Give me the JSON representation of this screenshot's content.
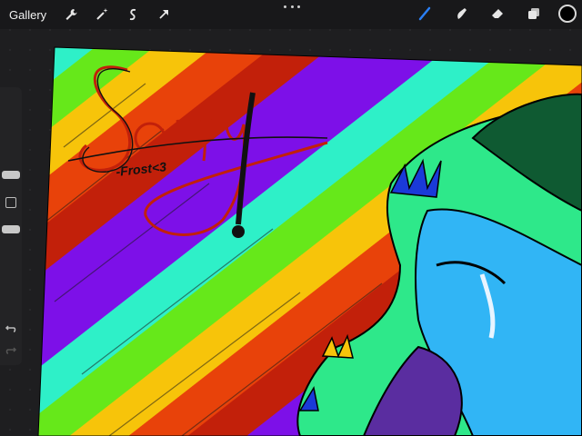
{
  "app": {
    "gallery_label": "Gallery"
  },
  "toolbar": {
    "left_tools": [
      "wrench-icon",
      "magic-wand-icon",
      "selection-icon",
      "transform-arrow-icon"
    ],
    "right_tools": [
      "brush-icon",
      "smudge-icon",
      "eraser-icon",
      "layers-icon"
    ],
    "active_tool": "brush-icon",
    "current_color": "#000000"
  },
  "artwork": {
    "title_text": "Sorry!",
    "signature": "-Frost<3",
    "stripe_colors": [
      "#7d10e8",
      "#ffa51a",
      "#e8420a",
      "#2ef0c8",
      "#66e81a",
      "#f7c40a",
      "#c2200a"
    ]
  }
}
